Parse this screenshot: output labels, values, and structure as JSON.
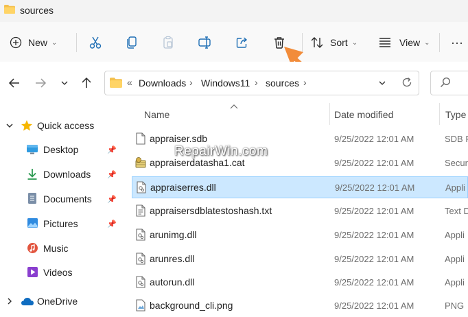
{
  "window": {
    "title": "sources"
  },
  "toolbar": {
    "new_label": "New",
    "cut_icon": "scissors-icon",
    "copy_icon": "copy-icon",
    "paste_icon": "paste-icon",
    "rename_icon": "rename-icon",
    "share_icon": "share-icon",
    "delete_icon": "trash-icon",
    "sort_label": "Sort",
    "view_label": "View",
    "more_label": "···"
  },
  "address": {
    "overflow": "«",
    "crumbs": [
      "Downloads",
      "Windows11",
      "sources"
    ],
    "separator": "›"
  },
  "nav": {
    "quick_access": "Quick access",
    "items": [
      {
        "label": "Desktop",
        "pinned": true
      },
      {
        "label": "Downloads",
        "pinned": true
      },
      {
        "label": "Documents",
        "pinned": true
      },
      {
        "label": "Pictures",
        "pinned": true
      },
      {
        "label": "Music",
        "pinned": false
      },
      {
        "label": "Videos",
        "pinned": false
      }
    ],
    "onedrive": "OneDrive"
  },
  "columns": {
    "name": "Name",
    "date": "Date modified",
    "type": "Type"
  },
  "files": [
    {
      "name": "appraiser.sdb",
      "date": "9/25/2022 12:01 AM",
      "type": "SDB F",
      "selected": false
    },
    {
      "name": "appraiserdatasha1.cat",
      "date": "9/25/2022 12:01 AM",
      "type": "Secur",
      "selected": false
    },
    {
      "name": "appraiserres.dll",
      "date": "9/25/2022 12:01 AM",
      "type": "Appli",
      "selected": true
    },
    {
      "name": "appraisersdblatestoshash.txt",
      "date": "9/25/2022 12:01 AM",
      "type": "Text D",
      "selected": false
    },
    {
      "name": "arunimg.dll",
      "date": "9/25/2022 12:01 AM",
      "type": "Appli",
      "selected": false
    },
    {
      "name": "arunres.dll",
      "date": "9/25/2022 12:01 AM",
      "type": "Appli",
      "selected": false
    },
    {
      "name": "autorun.dll",
      "date": "9/25/2022 12:01 AM",
      "type": "Appli",
      "selected": false
    },
    {
      "name": "background_cli.png",
      "date": "9/25/2022 12:01 AM",
      "type": "PNG",
      "selected": false
    }
  ],
  "watermark": "RepairWin.com",
  "colors": {
    "accent_arrow": "#f28c3a",
    "folder": "#f4c04d",
    "selection": "#cce8ff"
  }
}
